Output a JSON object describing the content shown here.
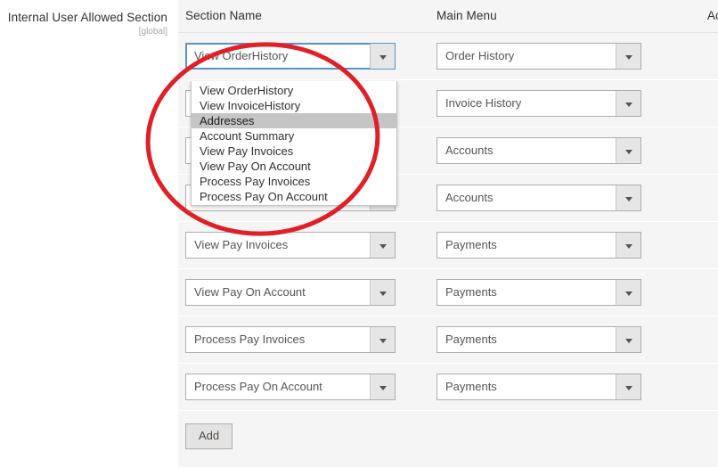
{
  "field": {
    "label": "Internal User Allowed Section",
    "scope": "[global]"
  },
  "table": {
    "headers": {
      "section_name": "Section Name",
      "main_menu": "Main Menu",
      "action": "Action"
    },
    "rows": [
      {
        "section_name": "View OrderHistory",
        "main_menu": "Order History",
        "delete_icon": "trash-icon"
      },
      {
        "section_name": "View InvoiceHistory",
        "main_menu": "Invoice History",
        "delete_icon": "trash-icon"
      },
      {
        "section_name": "Addresses",
        "main_menu": "Accounts",
        "delete_icon": "trash-icon"
      },
      {
        "section_name": "Account Summary",
        "main_menu": "Accounts",
        "delete_icon": "trash-icon"
      },
      {
        "section_name": "View Pay Invoices",
        "main_menu": "Payments",
        "delete_icon": "trash-icon"
      },
      {
        "section_name": "View Pay On Account",
        "main_menu": "Payments",
        "delete_icon": "trash-icon"
      },
      {
        "section_name": "Process Pay Invoices",
        "main_menu": "Payments",
        "delete_icon": "trash-icon"
      },
      {
        "section_name": "Process Pay On Account",
        "main_menu": "Payments",
        "delete_icon": "trash-icon"
      }
    ],
    "add_button": "Add"
  },
  "open_dropdown": {
    "for_row": 0,
    "selected_value": "View OrderHistory",
    "highlighted_option": "Addresses",
    "options": [
      "View OrderHistory",
      "View InvoiceHistory",
      "Addresses",
      "Account Summary",
      "View Pay Invoices",
      "View Pay On Account",
      "Process Pay Invoices",
      "Process Pay On Account"
    ]
  },
  "annotation": {
    "shape": "ellipse",
    "color": "#e01f26",
    "stroke_width": 5
  }
}
